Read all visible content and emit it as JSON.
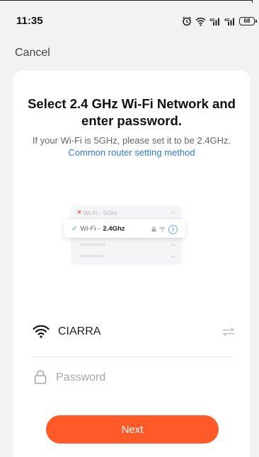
{
  "status_bar": {
    "time": "11:35",
    "battery": "68",
    "icons": [
      "alarm-icon",
      "wifi-icon",
      "signal-icon",
      "signal-icon",
      "battery-icon"
    ]
  },
  "nav": {
    "cancel_label": "Cancel"
  },
  "card": {
    "title": "Select 2.4 GHz Wi-Fi Network and enter password.",
    "subtitle_text": "If your Wi-Fi is 5GHz, please set it to be 2.4GHz.",
    "subtitle_link": "Common router setting method"
  },
  "illustration": {
    "row_5g_prefix": "Wi-Fi -",
    "row_5g_band": "5Ghz",
    "row_24_prefix": "Wi-Fi -",
    "row_24_band": "2.4Ghz"
  },
  "form": {
    "ssid": "CIARRA",
    "password_placeholder": "Password",
    "password_value": ""
  },
  "actions": {
    "next_label": "Next"
  },
  "colors": {
    "accent": "#ff5a28",
    "link": "#2f7bd1",
    "background": "#f2f2f4",
    "card": "#ffffff",
    "check": "#3bb55f",
    "cross": "#e45c4a"
  }
}
